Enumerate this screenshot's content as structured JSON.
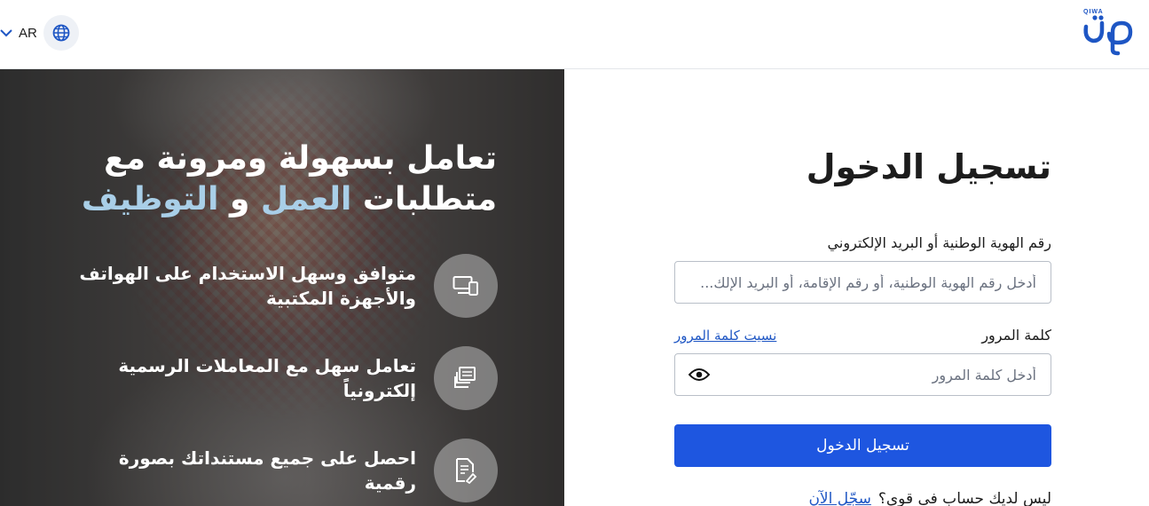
{
  "header": {
    "language_label": "AR",
    "logo_wordmark": "QIWA",
    "logo_text": "قوى",
    "icons": {
      "language_chevron": "chevron-down-icon",
      "globe": "globe-icon"
    },
    "brand_color": "#1e56c4"
  },
  "hero": {
    "title_line1": "تعامل بسهولة ومرونة مع",
    "title_line2_prefix": "متطلبات ",
    "title_accent1": "العمل",
    "title_connector": " و ",
    "title_accent2": "التوظيف",
    "accent_color": "#a9cfe8",
    "features": [
      {
        "icon": "devices-icon",
        "text": "متوافق وسهل الاستخدام على الهواتف والأجهزة المكتبية"
      },
      {
        "icon": "documents-stack-icon",
        "text": "تعامل سهل مع المعاملات الرسمية إلكترونياً"
      },
      {
        "icon": "document-sign-icon",
        "text": "احصل على جميع مستنداتك بصورة رقمية"
      }
    ]
  },
  "login": {
    "title": "تسجيل الدخول",
    "id_label": "رقم الهوية الوطنية أو البريد الإلكتروني",
    "id_placeholder": "أدخل رقم الهوية الوطنية، أو رقم الإقامة، أو البريد الإلك...",
    "id_value": "",
    "password_label": "كلمة المرور",
    "forgot_password": "نسيت كلمة المرور",
    "password_placeholder": "أدخل كلمة المرور",
    "password_value": "",
    "show_password_icon": "eye-icon",
    "submit_label": "تسجيل الدخول",
    "submit_color": "#1e56e0",
    "no_account_text": "ليس لديك حساب في قوى؟",
    "register_link": "سجّل الآن"
  }
}
